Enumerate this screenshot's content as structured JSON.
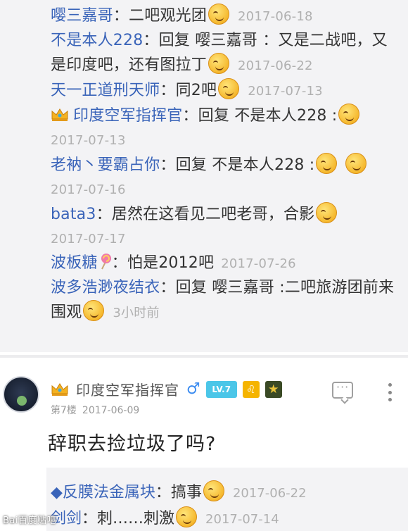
{
  "replies": [
    {
      "author": "嘤三嘉哥",
      "sep": "：",
      "text": "二吧观光团",
      "emojis": 1,
      "date": "2017-06-18"
    },
    {
      "author": "不是本人228",
      "sep": "：",
      "text": "回复 嘤三嘉哥 ：又是二战吧，又是印度吧，还有图拉丁",
      "emojis": 1,
      "date": "2017-06-22"
    },
    {
      "author": "天一正道刑天师",
      "sep": "：",
      "text": "同2吧",
      "emojis": 1,
      "date": "2017-07-13"
    },
    {
      "author": "印度空军指挥官",
      "sep": "：",
      "text": "回复 不是本人228 :",
      "emojis": 1,
      "date": "2017-07-13",
      "crown": true
    },
    {
      "author": "老衲丶要霸占你",
      "sep": "：",
      "text": "回复 不是本人228 :",
      "emojis": 2,
      "date": "2017-07-16"
    },
    {
      "author": "bata3",
      "sep": "：",
      "text": "居然在这看见二吧老哥，合影",
      "emojis": 1,
      "date": "2017-07-17"
    },
    {
      "author": "波板糖",
      "sep": "：",
      "text": "怕是2012吧",
      "emojis": 0,
      "date": "2017-07-26",
      "lollipop": true
    },
    {
      "author": "波多浩渺夜结衣",
      "sep": "：",
      "text": "回复 嘤三嘉哥 :二吧旅游团前来围观",
      "emojis": 1,
      "date": "3小时前"
    }
  ],
  "post": {
    "poster_name": "印度空军指挥官",
    "gender_symbol": "♂",
    "level_badge": "LV.7",
    "zodiac_symbol": "♌",
    "floor": "第7楼",
    "date": "2017-06-09",
    "body": "辞职去捡垃圾了吗?"
  },
  "sub_replies": [
    {
      "author": "◆反膜法金属块",
      "sep": "：",
      "text": "搞事",
      "emojis": 1,
      "date": "2017-06-22"
    },
    {
      "author": "剑剑",
      "sep": "：",
      "text": "刺……刺激",
      "emojis": 1,
      "date": "2017-07-14"
    }
  ],
  "watermark": "Bai百度贴吧"
}
